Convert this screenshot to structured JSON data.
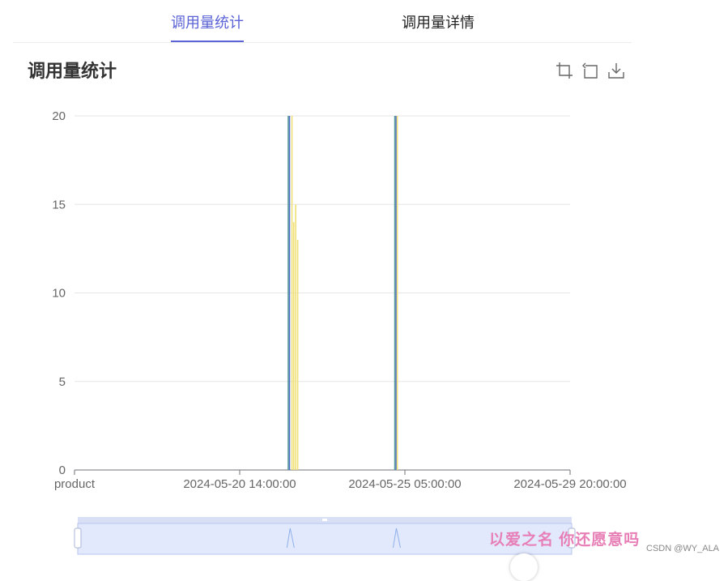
{
  "tabs": [
    {
      "label": "调用量统计",
      "active": true
    },
    {
      "label": "调用量详情",
      "active": false
    }
  ],
  "page_title": "调用量统计",
  "toolbox": {
    "icons": [
      "zoom-select-icon",
      "zoom-reset-icon",
      "download-icon"
    ]
  },
  "watermark": "以爱之名 你还愿意吗",
  "credit": "CSDN @WY_ALA",
  "colors": {
    "accent": "#5b63d6",
    "series_teal": "#5a9e9a",
    "series_yellow": "#f0e075",
    "series_blue": "#5470c6",
    "slider_fill": "#e2e9fd"
  },
  "chart_data": {
    "type": "bar",
    "ylim": [
      0,
      20
    ],
    "yticks": [
      0,
      5,
      10,
      15,
      20
    ],
    "xtick_labels": [
      "product",
      "2024-05-20 14:00:00",
      "2024-05-25 05:00:00",
      "2024-05-29 20:00:00"
    ],
    "xlim": [
      0,
      20
    ],
    "series": [
      {
        "color": "#5a9e9a",
        "points": [
          [
            8.6,
            20
          ],
          [
            12.9,
            20
          ]
        ]
      },
      {
        "color": "#5470c6",
        "points": [
          [
            8.65,
            20
          ],
          [
            12.95,
            20
          ]
        ]
      },
      {
        "color": "#f0e075",
        "points": [
          [
            8.75,
            20
          ],
          [
            8.82,
            14
          ],
          [
            8.9,
            15
          ],
          [
            8.98,
            13
          ],
          [
            13.0,
            20
          ]
        ]
      }
    ],
    "datazoom": {
      "start": 0,
      "end": 100
    }
  }
}
